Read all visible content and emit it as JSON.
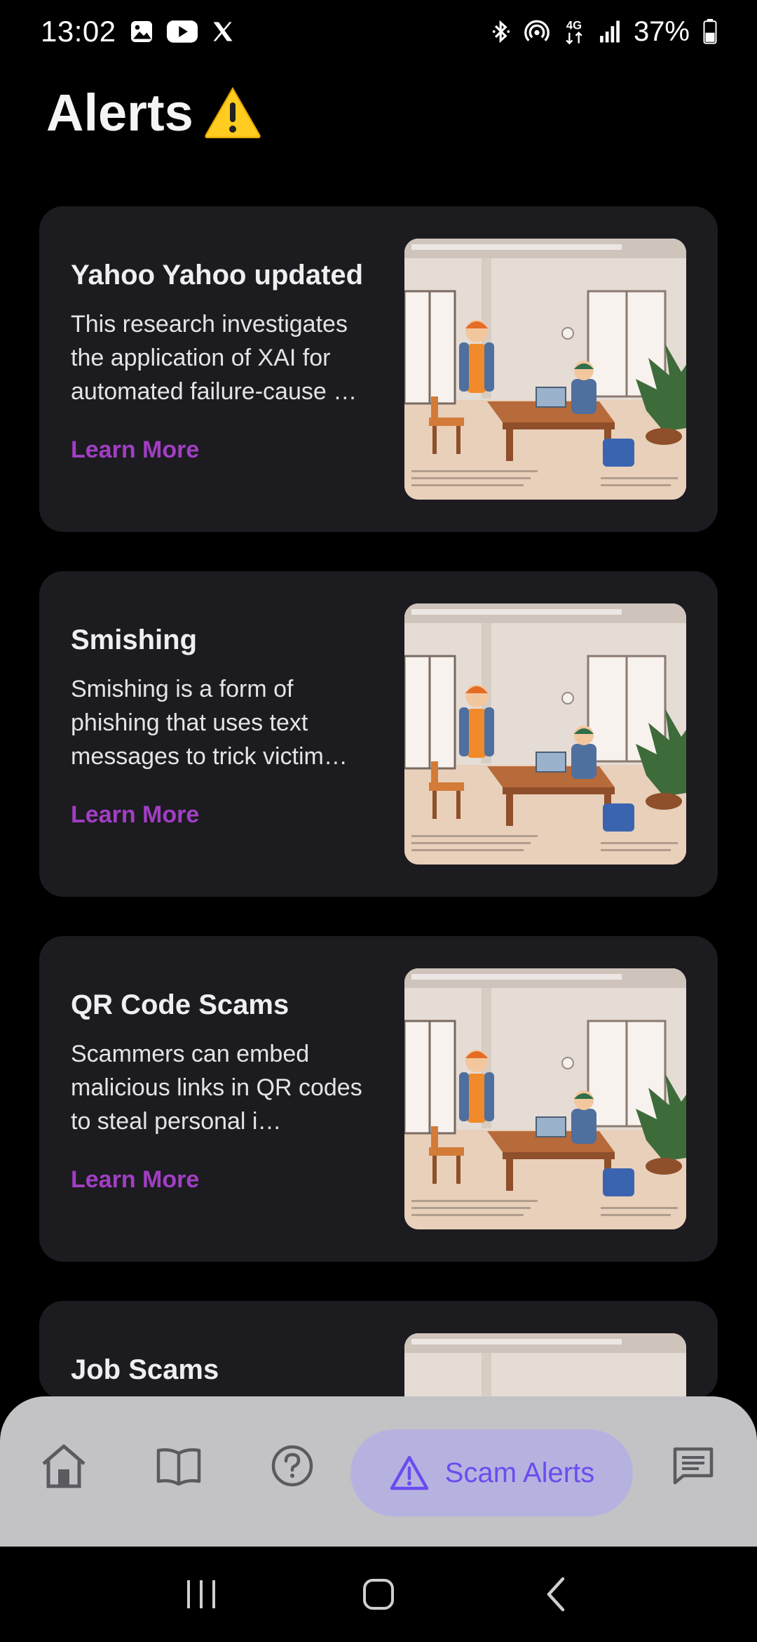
{
  "status_bar": {
    "time": "13:02",
    "battery_percent": "37%",
    "network": "4G",
    "left_icons": [
      "gallery-icon",
      "youtube-icon",
      "x-logo-icon"
    ],
    "right_icons": [
      "bluetooth-icon",
      "hotspot-icon",
      "network-4g-icon",
      "signal-icon",
      "battery-icon"
    ]
  },
  "header": {
    "title": "Alerts",
    "title_icon": "warning-emoji-icon"
  },
  "alerts": [
    {
      "title": "Yahoo Yahoo updated",
      "description": "This research investigates the application of XAI for automated failure-cause …",
      "link_label": "Learn More"
    },
    {
      "title": "Smishing",
      "description": "Smishing is a form of phishing that uses text messages to trick victim…",
      "link_label": "Learn More"
    },
    {
      "title": "QR Code Scams",
      "description": "Scammers can embed malicious links in QR codes to steal personal i…",
      "link_label": "Learn More"
    },
    {
      "title": "Job Scams"
    }
  ],
  "bottom_nav": {
    "items": [
      {
        "icon": "home-icon",
        "label": ""
      },
      {
        "icon": "book-icon",
        "label": ""
      },
      {
        "icon": "help-circle-icon",
        "label": ""
      },
      {
        "icon": "warning-triangle-icon",
        "label": "Scam Alerts",
        "active": true
      },
      {
        "icon": "chat-icon",
        "label": ""
      }
    ]
  },
  "colors": {
    "background": "#000000",
    "card": "#1c1b20",
    "link": "#a13ec3",
    "nav_background": "#c3c3c6",
    "nav_active_pill": "#b6b2e0",
    "nav_active_text": "#6a4cf0"
  }
}
